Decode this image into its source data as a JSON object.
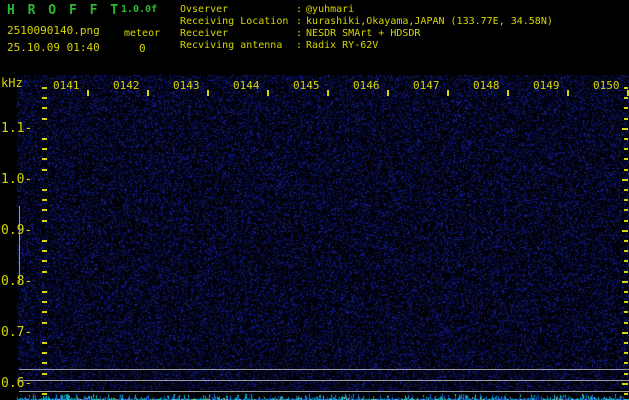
{
  "header": {
    "app_title": "H R O F F T",
    "version": "1.0.0f",
    "filename": "2510090140.png",
    "counter_label": "meteor",
    "counter_value": "0",
    "datetime": "25.10.09 01:40"
  },
  "info_panel": {
    "separator": ":",
    "rows": [
      {
        "label": "Ovserver",
        "value": "@yuhmari"
      },
      {
        "label": "Receiving Location",
        "value": "kurashiki,Okayama,JAPAN (133.77E, 34.58N)"
      },
      {
        "label": "Receiver",
        "value": "NESDR SMArt + HDSDR"
      },
      {
        "label": "Recviving antenna",
        "value": "Radix RY-62V"
      }
    ]
  },
  "spectrogram": {
    "y_axis_unit": "kHz",
    "y_tick_labels": [
      "1.1-",
      "1.0-",
      "0.9-",
      "0.8-",
      "0.7-",
      "0.6-"
    ],
    "x_tick_labels": [
      "0141",
      "0142",
      "0143",
      "0144",
      "0145",
      "0146",
      "0147",
      "0148",
      "0149",
      "0150"
    ]
  },
  "colors": {
    "text_yellow": "#d6d600",
    "title_green": "#2eb82e",
    "grid_gray": "#9a9a9a",
    "noise_blue": "#2030c0",
    "trace_cyan": "#00c0c8"
  }
}
